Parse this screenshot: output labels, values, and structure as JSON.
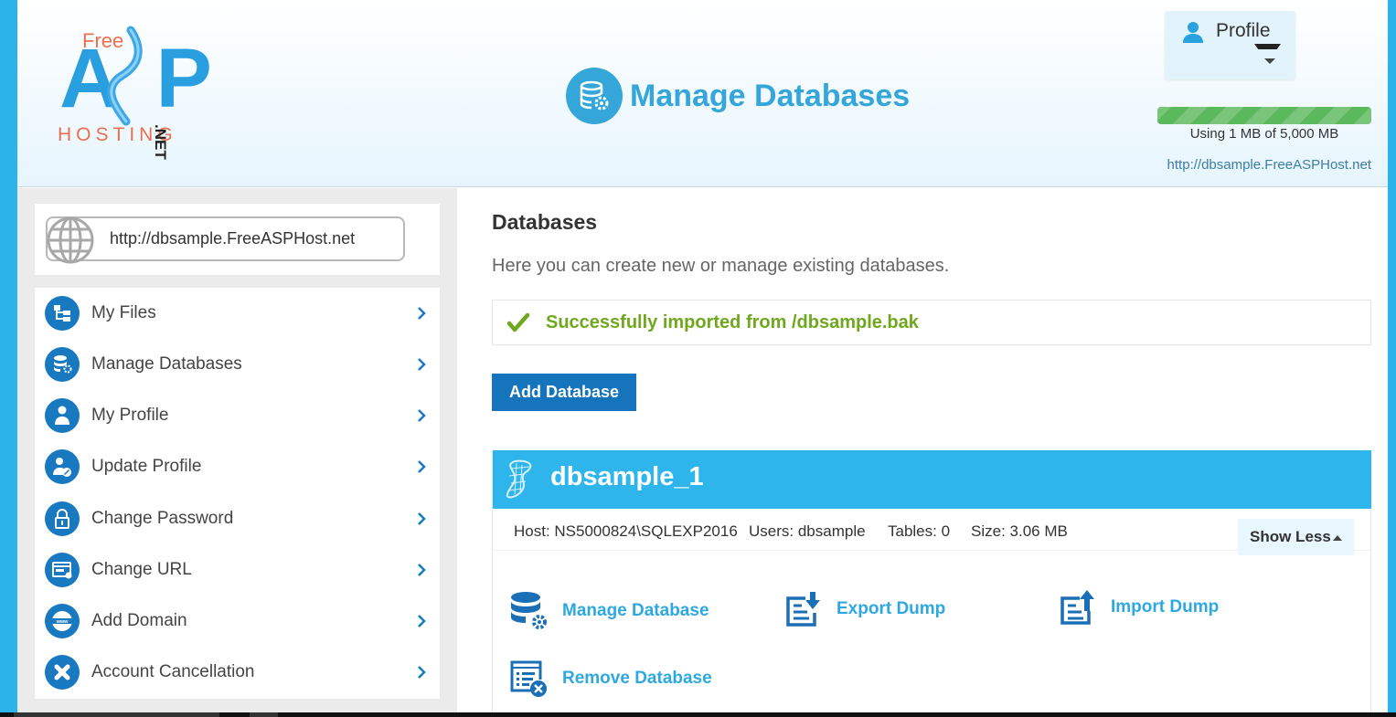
{
  "header": {
    "logo": {
      "top": "Free",
      "main": "ASP",
      "bottom": "HOSTING",
      "suffix": ".NET"
    },
    "page_title": "Manage Databases",
    "page_title_icon": "database-gear-icon",
    "profile": {
      "label": "Profile",
      "icon": "user-icon"
    },
    "quota": {
      "text": "Using 1 MB of 5,000 MB",
      "bar_fill_percent": 100,
      "color": "#5cb85c"
    },
    "site_url": "http://dbsample.FreeASPHost.net"
  },
  "sidebar": {
    "url_display": "http://dbsample.FreeASPHost.net",
    "items": [
      {
        "label": "My Files",
        "icon": "file-tree-icon"
      },
      {
        "label": "Manage Databases",
        "icon": "database-gear-icon"
      },
      {
        "label": "My Profile",
        "icon": "user-icon"
      },
      {
        "label": "Update Profile",
        "icon": "user-edit-icon"
      },
      {
        "label": "Change Password",
        "icon": "lock-icon"
      },
      {
        "label": "Change URL",
        "icon": "www-window-icon"
      },
      {
        "label": "Add Domain",
        "icon": "www-globe-icon"
      },
      {
        "label": "Account Cancellation",
        "icon": "close-circle-icon"
      }
    ]
  },
  "main": {
    "heading": "Databases",
    "lead": "Here you can create new or manage existing databases.",
    "alert": {
      "text": "Successfully imported from /dbsample.bak",
      "type": "success",
      "color": "#6fa81c"
    },
    "add_button": "Add Database",
    "database": {
      "name": "dbsample_1",
      "host": "Host: NS5000824\\SQLEXP2016",
      "users": "Users: dbsample",
      "tables": "Tables: 0",
      "size": "Size: 3.06 MB",
      "toggle_label": "Show Less",
      "actions": [
        {
          "label": "Manage Database",
          "icon": "database-gear-icon"
        },
        {
          "label": "Export Dump",
          "icon": "export-icon"
        },
        {
          "label": "Import Dump",
          "icon": "import-icon"
        },
        {
          "label": "Remove Database",
          "icon": "remove-list-icon"
        }
      ]
    }
  },
  "colors": {
    "accent": "#2db5ec",
    "primary_button": "#1574bb",
    "link": "#2ea8e1",
    "sidebar_icon": "#1878c0"
  }
}
